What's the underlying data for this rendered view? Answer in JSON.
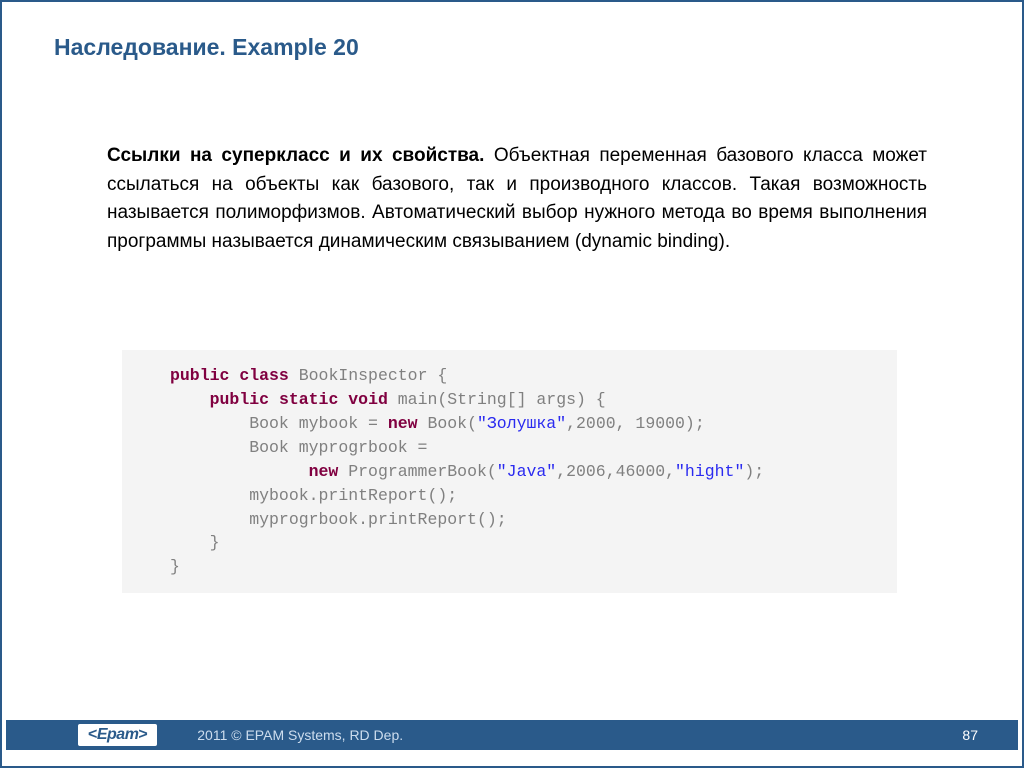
{
  "title": "Наследование. Example 20",
  "paragraph": {
    "lead": "Ссылки на суперкласс и их свойства.",
    "rest": " Объектная переменная базового класса может ссылаться на объекты как базового, так и производного классов. Такая возможность называется полиморфизмов. Автоматический выбор нужного метода во время выполнения программы называется динамическим связыванием (dynamic binding)."
  },
  "code": {
    "kw_public1": "public",
    "kw_class": "class",
    "cls_name": " BookInspector {",
    "kw_public2": "public",
    "kw_static": "static",
    "kw_void": "void",
    "main_sig": " main(String[] args) {",
    "line3a": "Book mybook = ",
    "kw_new1": "new",
    "line3b": " Book(",
    "str1": "\"Золушка\"",
    "line3c": ",2000, 19000);",
    "line4": "Book myprogrbook =",
    "kw_new2": "new",
    "line5a": " ProgrammerBook(",
    "str2": "\"Java\"",
    "line5b": ",2006,46000,",
    "str3": "\"hight\"",
    "line5c": ");",
    "line6": "mybook.printReport();",
    "line7": "myprogrbook.printReport();",
    "brace1": "}",
    "brace2": "}"
  },
  "footer": {
    "logo": "Epam",
    "copyright": "2011 © EPAM Systems, RD Dep.",
    "page": "87"
  }
}
